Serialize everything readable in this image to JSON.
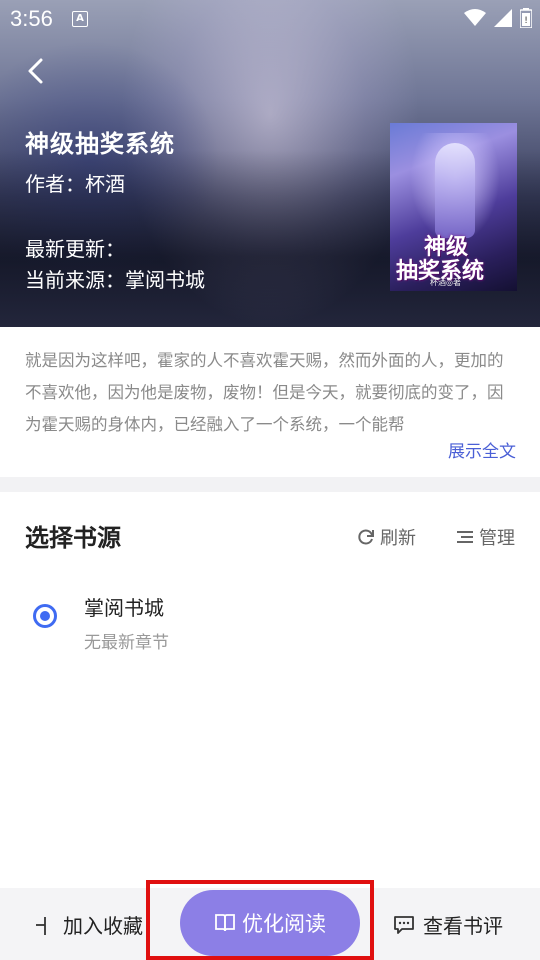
{
  "status_bar": {
    "time": "3:56",
    "notification_badge": "A"
  },
  "book": {
    "title": "神级抽奖系统",
    "author_line": "作者：杯酒",
    "latest_update_line": "最新更新：",
    "current_source_line": "当前来源：掌阅书城",
    "cover": {
      "title_line1": "神级",
      "title_line2": "抽奖系统",
      "author": "杯酒◎著"
    }
  },
  "description": {
    "text": "就是因为这样吧，霍家的人不喜欢霍天赐，然而外面的人，更加的不喜欢他，因为他是废物，废物！但是今天，就要彻底的变了，因为霍天赐的身体内，已经融入了一个系统，一个能帮",
    "expand_label": "展示全文"
  },
  "sources_section": {
    "title": "选择书源",
    "refresh_label": "刷新",
    "manage_label": "管理",
    "items": [
      {
        "name": "掌阅书城",
        "subtitle": "无最新章节",
        "selected": true
      }
    ]
  },
  "bottom_bar": {
    "add_favorite_label": "加入收藏",
    "optimize_read_label": "优化阅读",
    "view_reviews_label": "查看书评"
  },
  "colors": {
    "accent_blue": "#3f6bf2",
    "link_blue": "#4a5fd6",
    "primary_button": "#8c7fe6",
    "highlight_box": "#e01010"
  }
}
